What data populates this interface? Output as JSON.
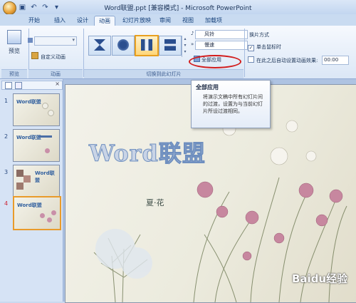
{
  "window": {
    "title": "Word联盟.ppt [兼容模式] - Microsoft PowerPoint"
  },
  "quick_access": {
    "save_icon": "save-icon",
    "undo_icon": "undo-icon",
    "redo_icon": "redo-icon",
    "customize_icon": "chevron-down-icon"
  },
  "ribbon_tabs": [
    "开始",
    "插入",
    "设计",
    "动画",
    "幻灯片放映",
    "审阅",
    "视图",
    "加载项"
  ],
  "active_tab": "动画",
  "ribbon": {
    "preview_group": {
      "preview_label": "预览",
      "group_label": "预览"
    },
    "animation_group": {
      "custom_animation_label": "自定义动画",
      "group_label": "动画"
    },
    "transition_group": {
      "sound_value": "风铃",
      "speed_value": "慢速",
      "apply_all_label": "全部应用",
      "group_label": "切换到此幻灯片"
    },
    "advance_group": {
      "heading": "换片方式",
      "on_click_label": "单击鼠标时",
      "on_click_checked": true,
      "after_label": "在此之后自动设置动画效果:",
      "after_checked": false,
      "after_time": "00:00"
    }
  },
  "tooltip": {
    "title": "全部应用",
    "body": "将演示文稿中所有幻灯片间的过渡，设置为与当前幻灯片所设过渡相同。"
  },
  "thumbnails": [
    {
      "number": "1",
      "title": "Word联盟"
    },
    {
      "number": "2",
      "title": "Word联盟"
    },
    {
      "number": "3",
      "title": "Word联盟"
    },
    {
      "number": "4",
      "title": "Word联盟"
    }
  ],
  "selected_slide": 4,
  "slide": {
    "headline": "Word联盟",
    "subtitle": "夏·花"
  },
  "watermark": "Baidu经验",
  "colors": {
    "accent": "#e8a020",
    "highlight_circle": "#d21c1c",
    "ribbon_blue": "#c9dbf1"
  }
}
